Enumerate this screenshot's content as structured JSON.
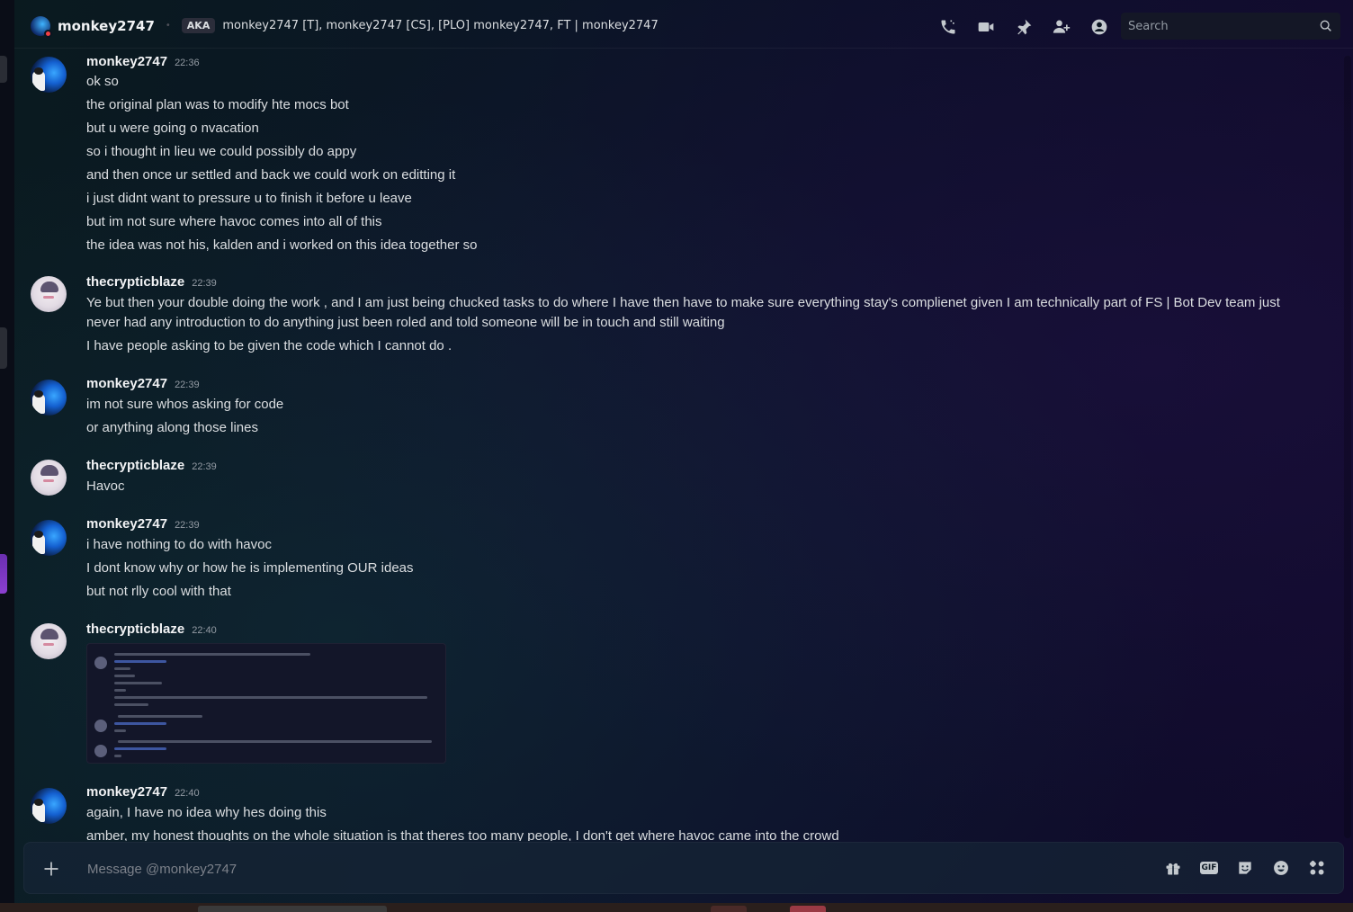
{
  "header": {
    "username": "monkey2747",
    "aka_label": "AKA",
    "aka_names": "monkey2747 [T], monkey2747 [CS], [PLO] monkey2747, FT | monkey2747",
    "search_placeholder": "Search"
  },
  "messages": [
    {
      "author": "monkey2747",
      "time": "22:36",
      "avatar": "monkey",
      "lines": [
        "ok so",
        "the original plan was to modify hte mocs bot",
        "but u were going o nvacation",
        "so i thought in lieu we could possibly do appy",
        "and then once ur settled and back we could work on editting it",
        "i just didnt want to pressure u to finish it before u leave",
        "but im not sure where havoc comes into all of this",
        "the idea was not his, kalden and i worked on this idea together so"
      ]
    },
    {
      "author": "thecrypticblaze",
      "time": "22:39",
      "avatar": "blaze",
      "lines": [
        "Ye but then your double doing the work , and I am just being chucked tasks to do where I have then have to make sure everything stay's complienet given I am technically part of FS | Bot Dev team just never had any introduction to do anything just been roled and told someone will be in touch and still waiting",
        "I have people asking to be given the code which I cannot do ."
      ]
    },
    {
      "author": "monkey2747",
      "time": "22:39",
      "avatar": "monkey",
      "lines": [
        "im not sure whos asking for code",
        "or anything along those lines"
      ]
    },
    {
      "author": "thecrypticblaze",
      "time": "22:39",
      "avatar": "blaze",
      "lines": [
        "Havoc"
      ]
    },
    {
      "author": "monkey2747",
      "time": "22:39",
      "avatar": "monkey",
      "lines": [
        "i have nothing to do with havoc",
        "I dont know why or how he is implementing OUR ideas",
        "but not rlly cool with that"
      ]
    },
    {
      "author": "thecrypticblaze",
      "time": "22:40",
      "avatar": "blaze",
      "lines": []
    },
    {
      "author": "monkey2747",
      "time": "22:40",
      "avatar": "monkey",
      "lines": [
        "again, I have no idea why hes doing this",
        "amber, my honest thoughts on the whole situation is that theres too many people, I don't get where havoc came into the crowd"
      ]
    }
  ],
  "composer": {
    "placeholder": "Message @monkey2747",
    "gif_label": "GIF"
  },
  "icons": {
    "header": [
      "phone-call-icon",
      "video-call-icon",
      "pin-icon",
      "add-friends-icon",
      "user-profile-icon",
      "search-icon"
    ],
    "composer": [
      "plus-icon",
      "gift-icon",
      "gif-icon",
      "sticker-icon",
      "emoji-icon",
      "apps-icon"
    ]
  },
  "colors": {
    "status_dnd": "#f23f43",
    "text_primary": "#f2f3f5",
    "text_muted": "#949ba4"
  }
}
